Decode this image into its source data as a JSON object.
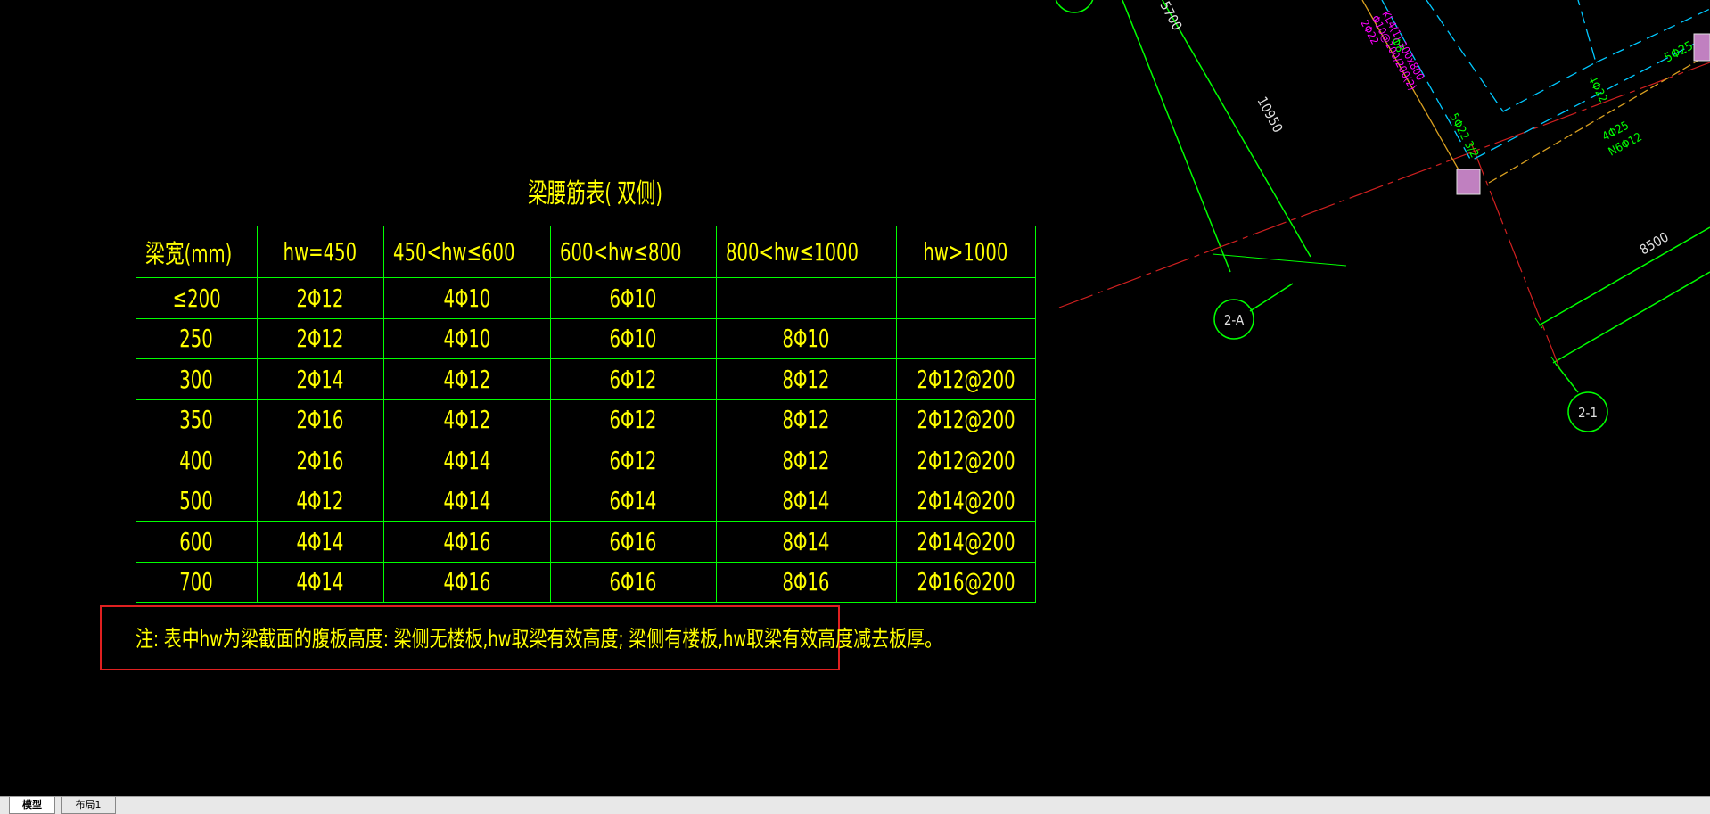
{
  "table": {
    "title": "梁腰筋表( 双侧)",
    "headers": [
      "梁宽(mm)",
      "hw=450",
      "450<hw≤600",
      "600<hw≤800",
      "800<hw≤1000",
      "hw>1000"
    ],
    "rows": [
      [
        "≤200",
        "2Φ12",
        "4Φ10",
        "6Φ10",
        "",
        ""
      ],
      [
        "250",
        "2Φ12",
        "4Φ10",
        "6Φ10",
        "8Φ10",
        ""
      ],
      [
        "300",
        "2Φ14",
        "4Φ12",
        "6Φ12",
        "8Φ12",
        "2Φ12@200"
      ],
      [
        "350",
        "2Φ16",
        "4Φ12",
        "6Φ12",
        "8Φ12",
        "2Φ12@200"
      ],
      [
        "400",
        "2Φ16",
        "4Φ14",
        "6Φ12",
        "8Φ12",
        "2Φ12@200"
      ],
      [
        "500",
        "4Φ12",
        "4Φ14",
        "6Φ14",
        "8Φ14",
        "2Φ14@200"
      ],
      [
        "600",
        "4Φ14",
        "4Φ16",
        "6Φ16",
        "8Φ14",
        "2Φ14@200"
      ],
      [
        "700",
        "4Φ14",
        "4Φ16",
        "6Φ16",
        "8Φ16",
        "2Φ16@200"
      ]
    ]
  },
  "note": "注: 表中hw为梁截面的腹板高度: 梁侧无楼板,hw取梁有效高度; 梁侧有楼板,hw取梁有效高度减去板厚。",
  "drawing": {
    "axis_labels": [
      "2-A",
      "2-1"
    ],
    "dimensions": [
      "10950",
      "8500",
      "5700"
    ],
    "rebar_labels": [
      "5Φ25",
      "5Φ22 3/2",
      "4Φ22",
      "4Φ25",
      "N6Φ12",
      "Φ8",
      "KL4(1) 300x800",
      "Φ10@100/200(2)",
      "2Φ22"
    ]
  },
  "tabs": [
    "模型",
    "布局1"
  ],
  "colors": {
    "background": "#000000",
    "text": "#ffff00",
    "table_lines": "#00ff00",
    "highlight_box": "#e02020",
    "dim_lines": "#00ff00",
    "hidden_lines": "#00c8ff",
    "column": "#c080c0",
    "magenta_text": "#ff00ff",
    "axis_line": "#d02020"
  }
}
